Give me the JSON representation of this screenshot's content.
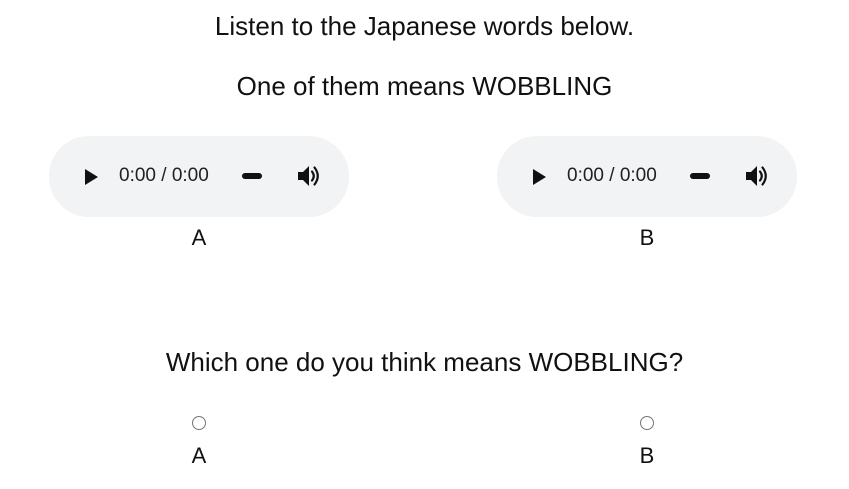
{
  "instruction": "Listen to the Japanese words below.",
  "prompt": "One of them means WOBBLING",
  "question": "Which one do you think means WOBBLING?",
  "players": [
    {
      "label": "A",
      "time": "0:00 / 0:00",
      "play_icon": "play-icon",
      "volume_icon": "volume-icon"
    },
    {
      "label": "B",
      "time": "0:00 / 0:00",
      "play_icon": "play-icon",
      "volume_icon": "volume-icon"
    }
  ],
  "choices": [
    {
      "label": "A",
      "selected": false
    },
    {
      "label": "B",
      "selected": false
    }
  ],
  "colors": {
    "player_background": "#f1f3f4",
    "text": "#111111",
    "radio_border": "#767676"
  }
}
